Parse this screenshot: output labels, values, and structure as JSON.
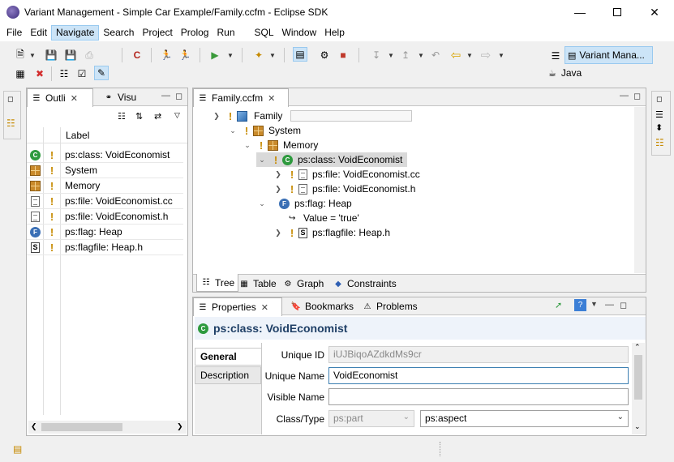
{
  "window": {
    "title": "Variant Management - Simple Car Example/Family.ccfm - Eclipse SDK"
  },
  "menu": [
    "File",
    "Edit",
    "Navigate",
    "Search",
    "Project",
    "Prolog",
    "Run",
    "SQL",
    "Window",
    "Help"
  ],
  "menu_active": "Navigate",
  "perspectives": {
    "variant": "Variant Mana...",
    "java": "Java"
  },
  "outline": {
    "tabs": [
      {
        "label": "Outli"
      },
      {
        "label": "Visu"
      }
    ],
    "header": "Label",
    "rows": [
      {
        "icon": "class-icon",
        "label": "ps:class: VoidEconomist"
      },
      {
        "icon": "component-icon",
        "label": "System"
      },
      {
        "icon": "component-icon",
        "label": "Memory"
      },
      {
        "icon": "file-icon",
        "label": "ps:file: VoidEconomist.cc"
      },
      {
        "icon": "file-icon",
        "label": "ps:file: VoidEconomist.h"
      },
      {
        "icon": "flag-icon",
        "label": "ps:flag: Heap"
      },
      {
        "icon": "flagfile-icon",
        "label": "ps:flagfile: Heap.h"
      }
    ]
  },
  "editor": {
    "tab": "Family.ccfm",
    "tree": [
      {
        "label": "Family",
        "level": 0,
        "icon": "cube-icon"
      },
      {
        "label": "System",
        "level": 1,
        "icon": "component-icon"
      },
      {
        "label": "Memory",
        "level": 2,
        "icon": "component-icon"
      },
      {
        "label": "ps:class: VoidEconomist",
        "level": 3,
        "icon": "class-icon",
        "selected": true
      },
      {
        "label": "ps:file: VoidEconomist.cc",
        "level": 4,
        "icon": "file-icon"
      },
      {
        "label": "ps:file: VoidEconomist.h",
        "level": 4,
        "icon": "file-icon"
      },
      {
        "label": "ps:flag: Heap",
        "level": 3,
        "icon": "flag-icon"
      },
      {
        "label": "Value = 'true'",
        "level": 4,
        "icon": "value-icon"
      },
      {
        "label": "ps:flagfile: Heap.h",
        "level": 4,
        "icon": "flagfile-icon"
      }
    ],
    "bottom_tabs": [
      "Tree",
      "Table",
      "Graph",
      "Constraints"
    ]
  },
  "properties": {
    "tabs": [
      "Properties",
      "Bookmarks",
      "Problems"
    ],
    "heading": "ps:class: VoidEconomist",
    "side_tabs": [
      "General",
      "Description"
    ],
    "fields": {
      "unique_id_label": "Unique ID",
      "unique_id": "iUJBiqoAZdkdMs9cr",
      "unique_name_label": "Unique Name",
      "unique_name": "VoidEconomist",
      "visible_name_label": "Visible Name",
      "visible_name": "",
      "class_type_label": "Class/Type",
      "class_value": "ps:part",
      "type_value": "ps:aspect"
    }
  }
}
